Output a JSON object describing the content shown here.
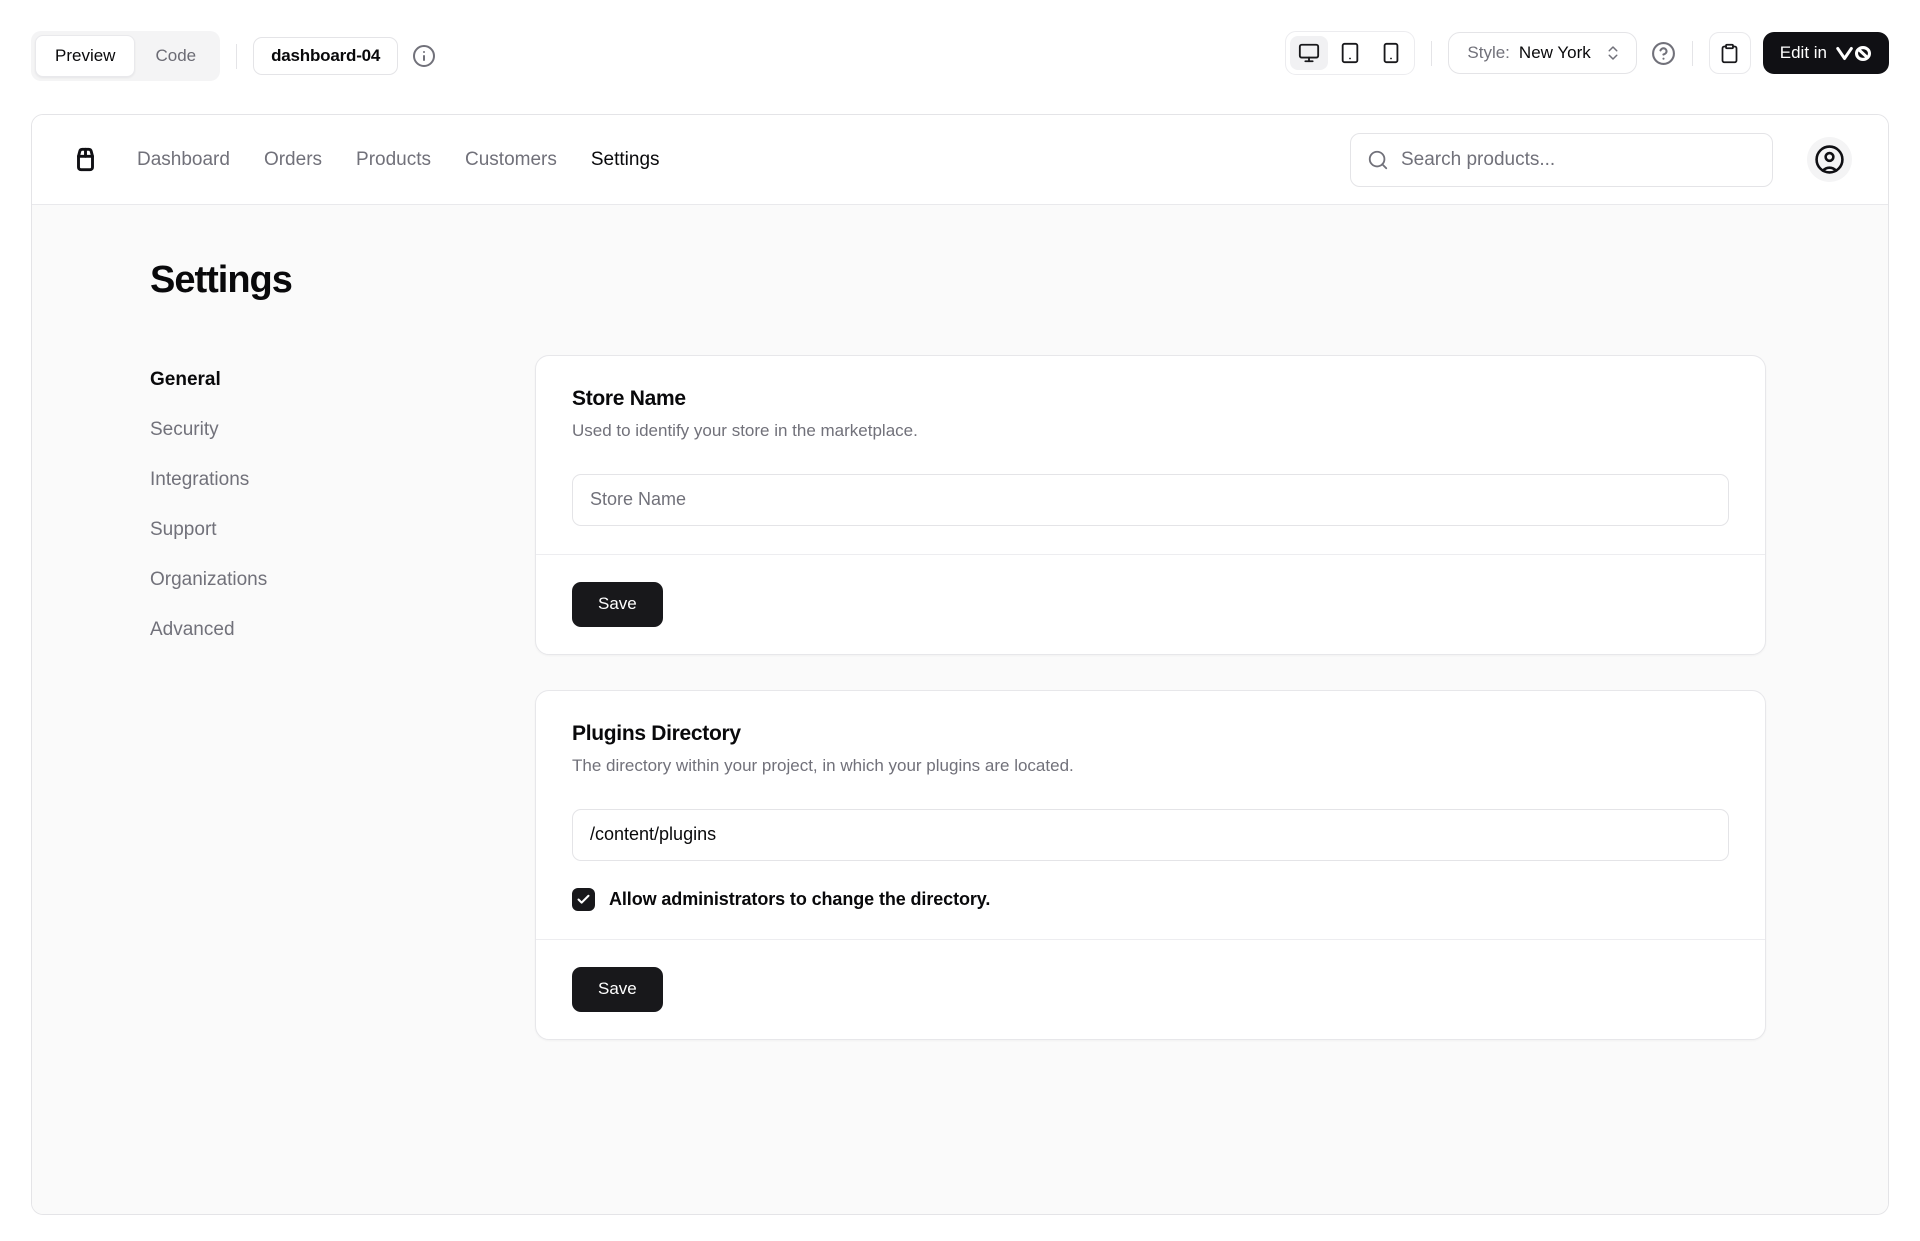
{
  "toolbar": {
    "view_tabs": {
      "preview": "Preview",
      "code": "Code"
    },
    "block_badge": "dashboard-04",
    "style": {
      "label": "Style:",
      "value": "New York"
    },
    "edit_button_label": "Edit in",
    "icons": {
      "info": "info-circle-icon",
      "devices": [
        "monitor-icon",
        "tablet-icon",
        "smartphone-icon"
      ],
      "style_chevrons": "chevrons-up-down-icon",
      "help": "help-circle-icon",
      "copy": "clipboard-icon",
      "edit_logo": "v0-logo"
    }
  },
  "preview": {
    "nav": {
      "logo_icon": "store-icon",
      "links": [
        "Dashboard",
        "Orders",
        "Products",
        "Customers",
        "Settings"
      ],
      "active_link": "Settings",
      "search_placeholder": "Search products...",
      "search_icon": "search-icon",
      "avatar_icon": "circle-user-icon"
    },
    "page": {
      "title": "Settings",
      "sidebar": [
        "General",
        "Security",
        "Integrations",
        "Support",
        "Organizations",
        "Advanced"
      ],
      "sidebar_active": "General",
      "store_card": {
        "title": "Store Name",
        "description": "Used to identify your store in the marketplace.",
        "input_placeholder": "Store Name",
        "input_value": "",
        "save_label": "Save"
      },
      "plugins_card": {
        "title": "Plugins Directory",
        "description": "The directory within your project, in which your plugins are located.",
        "input_value": "/content/plugins",
        "checkbox_label": "Allow administrators to change the directory.",
        "checkbox_checked": true,
        "checkbox_icon": "check-icon",
        "save_label": "Save"
      }
    }
  },
  "colors": {
    "text": "#09090b",
    "muted": "#71717a",
    "border": "#e4e4e7",
    "content_bg": "#fafafa",
    "primary_button": "#18181b",
    "active_segment_bg": "#f4f4f5"
  }
}
